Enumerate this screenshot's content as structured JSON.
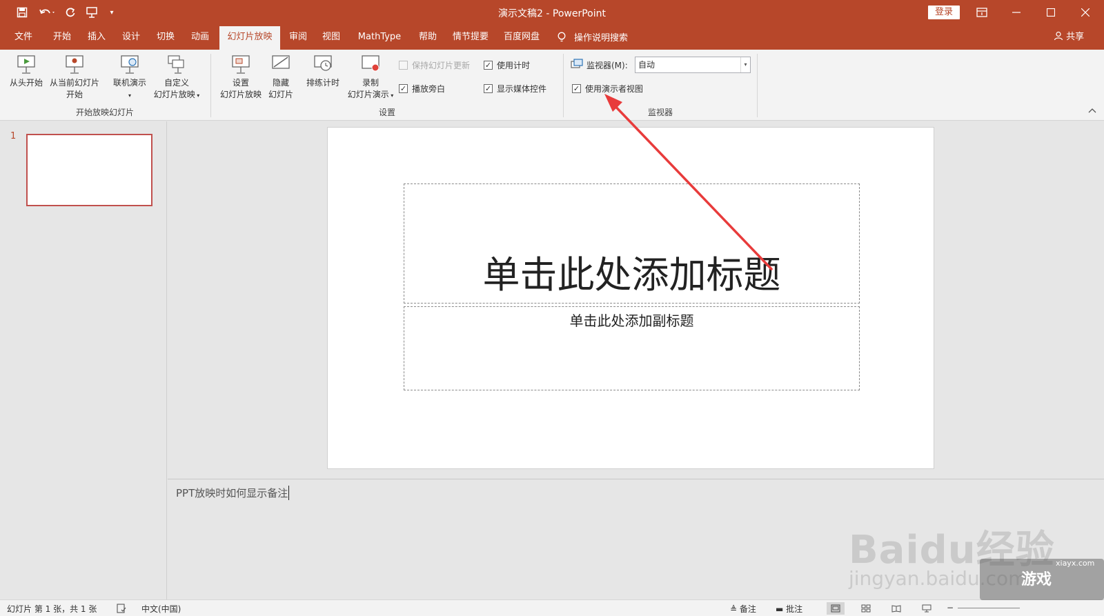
{
  "window": {
    "title": "演示文稿2 - PowerPoint",
    "login": "登录"
  },
  "tabs": [
    "文件",
    "开始",
    "插入",
    "设计",
    "切换",
    "动画",
    "幻灯片放映",
    "审阅",
    "视图",
    "MathType",
    "帮助",
    "情节提要",
    "百度网盘"
  ],
  "active_tab_index": 6,
  "tell_me": "操作说明搜索",
  "share": "共享",
  "ribbon": {
    "group_start": {
      "label": "开始放映幻灯片",
      "from_beginning": "从头开始",
      "from_current_line1": "从当前幻灯片",
      "from_current_line2": "开始",
      "online": "联机演示",
      "custom_line1": "自定义",
      "custom_line2": "幻灯片放映"
    },
    "group_setup": {
      "label": "设置",
      "setup_line1": "设置",
      "setup_line2": "幻灯片放映",
      "hide_line1": "隐藏",
      "hide_line2": "幻灯片",
      "rehearse": "排练计时",
      "record_line1": "录制",
      "record_line2": "幻灯片演示",
      "keep_updated": "保持幻灯片更新",
      "play_narrations": "播放旁白",
      "use_timings": "使用计时",
      "show_media_controls": "显示媒体控件"
    },
    "group_monitors": {
      "label": "监视器",
      "monitor_label": "监视器(M):",
      "monitor_value": "自动",
      "presenter_view": "使用演示者视图"
    }
  },
  "thumbnails": [
    {
      "number": "1"
    }
  ],
  "slide": {
    "title_placeholder": "单击此处添加标题",
    "subtitle_placeholder": "单击此处添加副标题"
  },
  "notes": {
    "text": "PPT放映时如何显示备注"
  },
  "status": {
    "slide_info": "幻灯片 第 1 张，共 1 张",
    "language": "中文(中国)",
    "notes": "备注",
    "comments": "批注"
  },
  "watermark": {
    "brand": "Baidu经验",
    "url": "jingyan.baidu.com",
    "site_name": "游戏",
    "site_url": "xiayx.com"
  },
  "colors": {
    "accent": "#b7472a",
    "ribbon_bg": "#f3f3f3",
    "workspace_bg": "#e6e6e6",
    "annotation_arrow": "#e83b3b"
  }
}
